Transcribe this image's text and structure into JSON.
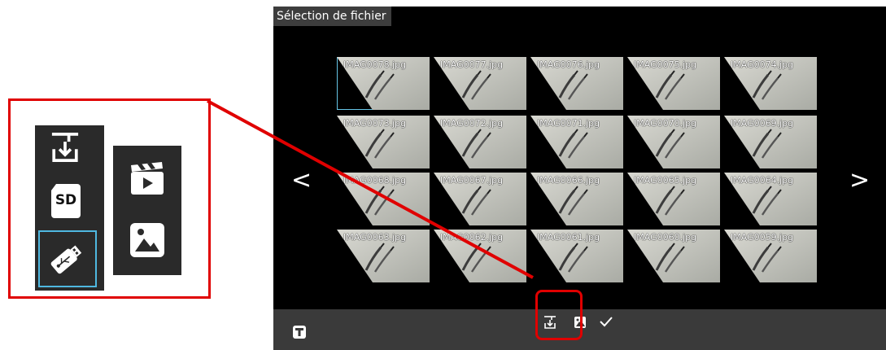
{
  "window": {
    "title": "Sélection de fichier"
  },
  "navigation": {
    "prev_glyph": "<",
    "next_glyph": ">"
  },
  "file_grid": {
    "selected_index": 0,
    "files": [
      "IMAG0078.jpg",
      "IMAG0077.jpg",
      "IMAG0076.jpg",
      "IMAG0075.jpg",
      "IMAG0074.jpg",
      "IMAG0073.jpg",
      "IMAG0072.jpg",
      "IMAG0071.jpg",
      "IMAG0070.jpg",
      "IMAG0069.jpg",
      "IMAG0068.jpg",
      "IMAG0067.jpg",
      "IMAG0066.jpg",
      "IMAG0065.jpg",
      "IMAG0064.jpg",
      "IMAG0063.jpg",
      "IMAG0062.jpg",
      "IMAG0061.jpg",
      "IMAG0060.jpg",
      "IMAG0059.jpg"
    ]
  },
  "bottom_bar": {
    "icons": [
      "mode-icon",
      "save-to-storage-icon",
      "image-icon",
      "checkmark-icon"
    ]
  },
  "callout": {
    "storage_icons": [
      "save-to-storage-icon",
      "sd-card-icon",
      "usb-drive-icon"
    ],
    "media_icons": [
      "video-clapper-icon",
      "image-icon"
    ],
    "sd_label": "SD",
    "selected_storage": "usb-drive-icon"
  },
  "colors": {
    "highlight": "#e00000",
    "selection": "#66c6e6",
    "title_bg": "#3d3d3d",
    "bottom_bar_bg": "#3a3a3a"
  }
}
